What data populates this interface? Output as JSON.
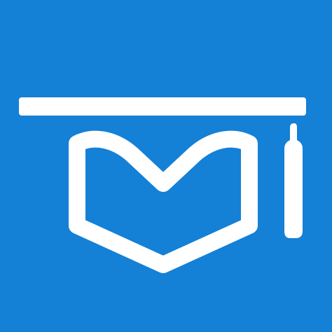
{
  "icon": {
    "name": "graduation-cap-book-icon",
    "description_colors": {
      "background": "#1480D6",
      "foreground": "#FFFFFF"
    }
  }
}
